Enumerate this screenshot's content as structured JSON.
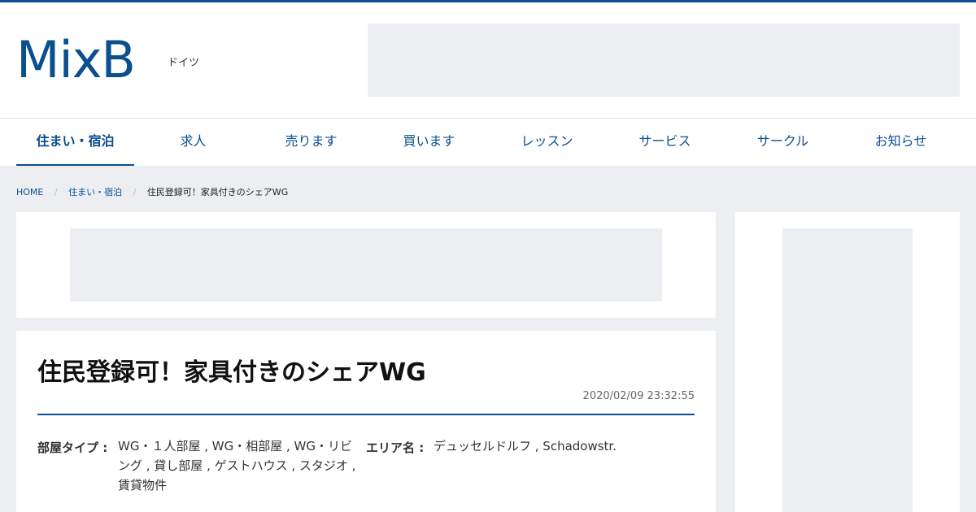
{
  "header": {
    "logo": "MixB",
    "region": "ドイツ"
  },
  "nav": {
    "items": [
      {
        "label": "住まい・宿泊",
        "active": true
      },
      {
        "label": "求人",
        "active": false
      },
      {
        "label": "売ります",
        "active": false
      },
      {
        "label": "買います",
        "active": false
      },
      {
        "label": "レッスン",
        "active": false
      },
      {
        "label": "サービス",
        "active": false
      },
      {
        "label": "サークル",
        "active": false
      },
      {
        "label": "お知らせ",
        "active": false
      }
    ]
  },
  "breadcrumb": {
    "home": "HOME",
    "category": "住まい・宿泊",
    "current": "住民登録可！家具付きのシェアWG"
  },
  "post": {
    "title": "住民登録可！家具付きのシェアWG",
    "date": "2020/02/09 23:32:55",
    "room_type_label": "部屋タイプ :",
    "room_type_value": "WG・１人部屋 , WG・相部屋 , WG・リビング , 貸し部屋 , ゲストハウス , スタジオ , 賃貸物件",
    "area_label": "エリア名 :",
    "area_value": "デュッセルドルフ , Schadowstr."
  },
  "colors": {
    "brand": "#0a4f8f",
    "background": "#eceef1"
  }
}
